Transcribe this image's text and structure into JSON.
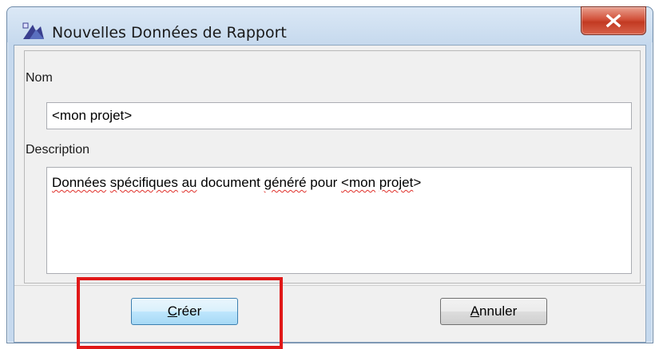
{
  "window": {
    "title": "Nouvelles Données de Rapport",
    "app_icon": "report-app-icon",
    "close_icon": "close-icon"
  },
  "form": {
    "name_label": "Nom",
    "name_value": "<mon projet>",
    "description_label": "Description",
    "description_parts": {
      "w1": "Données",
      "s1": " ",
      "w2": "spécifiques",
      "s2": " ",
      "w3": "au",
      "s3": " document ",
      "w4": "généré",
      "s4": " pour  ",
      "w5": "<mon",
      "s5": " ",
      "w6": "projet",
      "s6": ">"
    }
  },
  "buttons": {
    "create_first": "C",
    "create_rest": "réer",
    "cancel_first": "A",
    "cancel_rest": "nnuler"
  },
  "colors": {
    "highlight": "#e01818",
    "close_button": "#c23a22",
    "title_bar": "#c7daee"
  }
}
